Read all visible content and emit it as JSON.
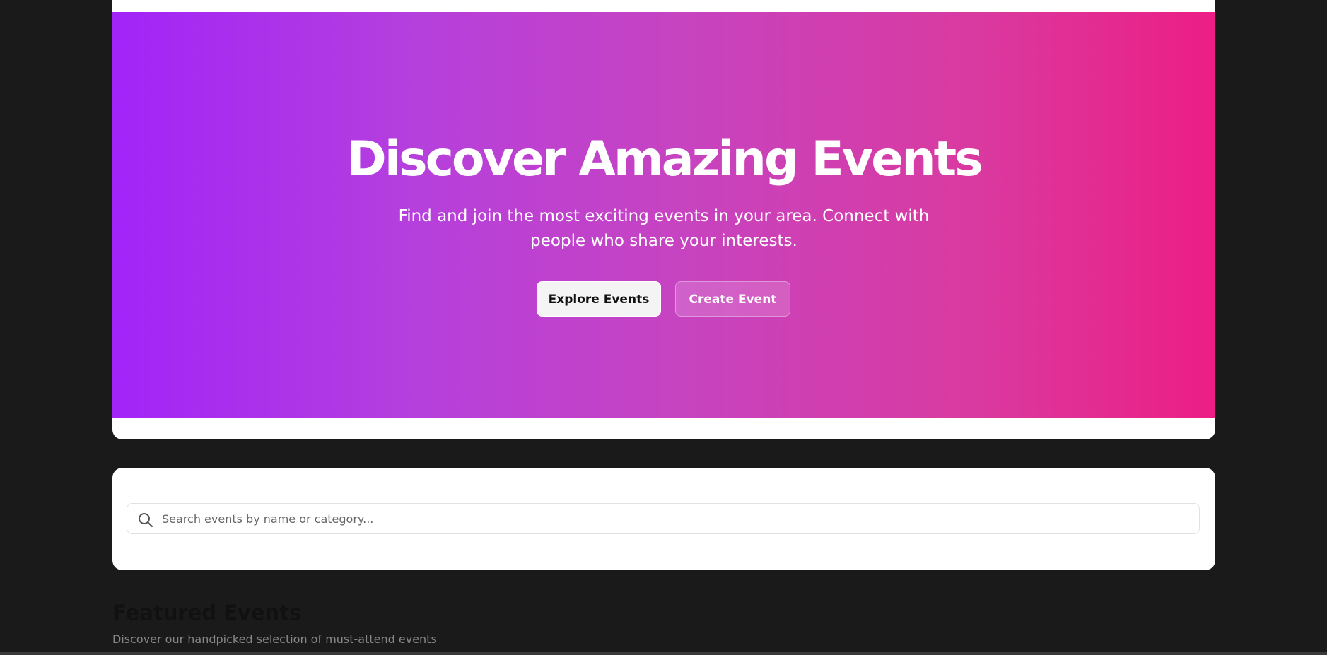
{
  "hero": {
    "title": "Discover Amazing Events",
    "subtitle": "Find and join the most exciting events in your area. Connect with people who share your interests.",
    "explore_button_label": "Explore Events",
    "create_button_label": "Create Event",
    "gradient_start_color": "#a324f8",
    "gradient_end_color": "#ec1e85"
  },
  "search": {
    "placeholder": "Search events by name or category...",
    "value": "",
    "icon": "search-icon"
  },
  "featured": {
    "title": "Featured Events",
    "subtitle": "Discover our handpicked selection of must-attend events"
  }
}
